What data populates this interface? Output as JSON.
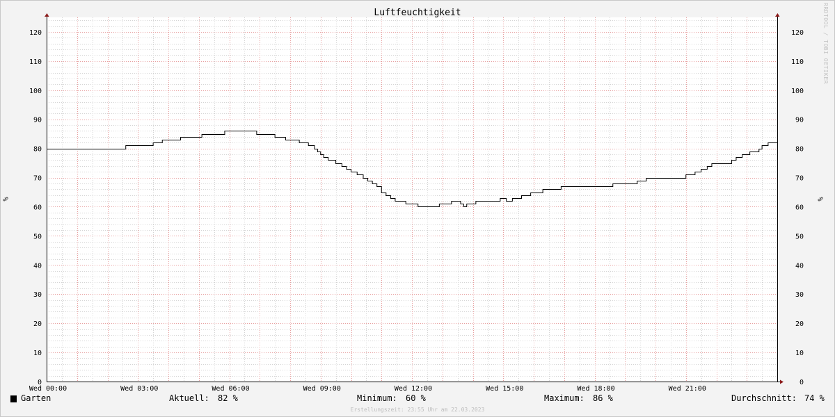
{
  "watermark": "RRDTOOL / TOBI OETIKER",
  "left_unit": "%",
  "right_unit": "%",
  "legend": {
    "series_name": "Garten",
    "current_label": "Aktuell:",
    "current_value": "82 %",
    "min_label": "Minimum:",
    "min_value": "60 %",
    "max_label": "Maximum:",
    "max_value": "86 %",
    "avg_label": "Durchschnitt:",
    "avg_value": "74 %"
  },
  "footer": "Erstellungszeit: 23:55 Uhr am 22.03.2023",
  "colors": {
    "line": "#000000",
    "major_grid": "#e8a0a0",
    "minor_grid": "#d4d4d4",
    "axis": "#8b1a1a",
    "background": "#ffffff"
  },
  "chart_data": {
    "type": "line",
    "title": "Luftfeuchtigkeit",
    "xlabel": "",
    "ylabel": "%",
    "xlim": [
      0,
      24
    ],
    "ylim": [
      0,
      125
    ],
    "yticks": [
      0,
      10,
      20,
      30,
      40,
      50,
      60,
      70,
      80,
      90,
      100,
      110,
      120
    ],
    "xtick_hours": [
      0,
      3,
      6,
      9,
      12,
      15,
      18,
      21
    ],
    "xtick_labels": [
      "Wed 00:00",
      "Wed 03:00",
      "Wed 06:00",
      "Wed 09:00",
      "Wed 12:00",
      "Wed 15:00",
      "Wed 18:00",
      "Wed 21:00"
    ],
    "grid": true,
    "series": [
      {
        "name": "Garten",
        "x": [
          0,
          2.6,
          3.5,
          3.8,
          4.4,
          5.1,
          5.85,
          6.9,
          7.5,
          7.85,
          8.3,
          8.6,
          8.8,
          8.9,
          9.0,
          9.1,
          9.25,
          9.5,
          9.7,
          9.85,
          10.0,
          10.2,
          10.4,
          10.55,
          10.7,
          10.85,
          11.0,
          11.15,
          11.3,
          11.45,
          11.8,
          12.2,
          12.9,
          13.3,
          13.6,
          13.7,
          13.8,
          14.1,
          14.9,
          15.1,
          15.3,
          15.6,
          15.9,
          16.3,
          16.9,
          18.6,
          19.4,
          19.7,
          20.3,
          21.0,
          21.3,
          21.5,
          21.7,
          21.85,
          22.5,
          22.65,
          22.85,
          23.1,
          23.4,
          23.5,
          23.7,
          24.0
        ],
        "values": [
          80,
          81,
          82,
          83,
          84,
          85,
          86,
          85,
          84,
          83,
          82,
          81,
          80,
          79,
          78,
          77,
          76,
          75,
          74,
          73,
          72,
          71,
          70,
          69,
          68,
          67,
          65,
          64,
          63,
          62,
          61,
          60,
          61,
          62,
          61,
          60,
          61,
          62,
          63,
          62,
          63,
          64,
          65,
          66,
          67,
          68,
          69,
          70,
          70,
          71,
          72,
          73,
          74,
          75,
          76,
          77,
          78,
          79,
          80,
          81,
          82,
          82
        ]
      }
    ]
  }
}
